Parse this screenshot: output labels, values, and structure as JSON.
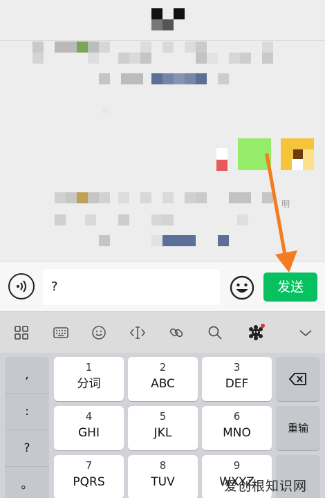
{
  "chat": {
    "side_label": "明"
  },
  "input_bar": {
    "text_value": "?",
    "send_label": "发送"
  },
  "keyboard": {
    "symbols": [
      ",",
      ":",
      "?",
      "。"
    ],
    "keys": [
      {
        "num": "1",
        "letters": "分词"
      },
      {
        "num": "2",
        "letters": "ABC"
      },
      {
        "num": "3",
        "letters": "DEF"
      },
      {
        "num": "4",
        "letters": "GHI"
      },
      {
        "num": "5",
        "letters": "JKL"
      },
      {
        "num": "6",
        "letters": "MNO"
      },
      {
        "num": "7",
        "letters": "PQRS"
      },
      {
        "num": "8",
        "letters": "TUV"
      },
      {
        "num": "9",
        "letters": "WXYZ"
      }
    ],
    "reenter_label": "重输"
  },
  "watermark": "爱创根知识网",
  "colors": {
    "send_green": "#07c160",
    "bubble_green": "#95ec69",
    "arrow_orange": "#f47b20",
    "notification_red": "#e03030"
  }
}
